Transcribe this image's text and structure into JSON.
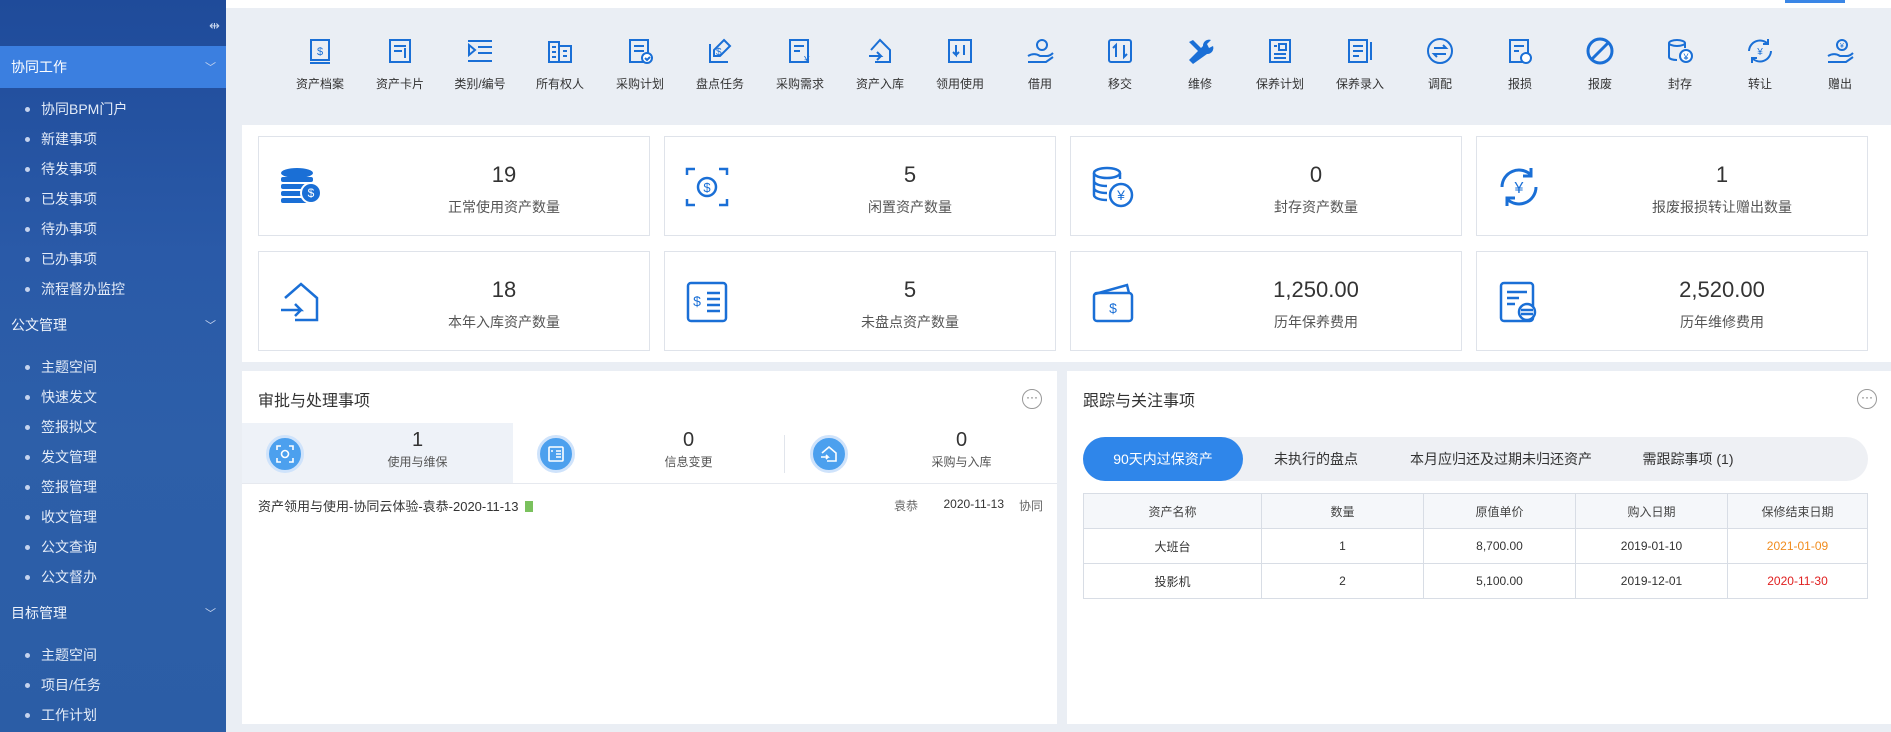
{
  "sidebar": {
    "collapse_icon": "collapse-arrows-icon",
    "groups": [
      {
        "label": "协同工作",
        "items": [
          "协同BPM门户",
          "新建事项",
          "待发事项",
          "已发事项",
          "待办事项",
          "已办事项",
          "流程督办监控"
        ]
      },
      {
        "label": "公文管理",
        "items": [
          "主题空间",
          "快速发文",
          "签报拟文",
          "发文管理",
          "签报管理",
          "收文管理",
          "公文查询",
          "公文督办"
        ]
      },
      {
        "label": "目标管理",
        "items": [
          "主题空间",
          "项目/任务",
          "工作计划"
        ]
      }
    ]
  },
  "toolbar": {
    "items": [
      {
        "label": "资产档案",
        "icon": "asset-file-icon"
      },
      {
        "label": "资产卡片",
        "icon": "asset-card-icon"
      },
      {
        "label": "类别/编号",
        "icon": "category-list-icon"
      },
      {
        "label": "所有权人",
        "icon": "building-icon"
      },
      {
        "label": "采购计划",
        "icon": "purchase-plan-icon"
      },
      {
        "label": "盘点任务",
        "icon": "inventory-task-icon"
      },
      {
        "label": "采购需求",
        "icon": "purchase-demand-icon"
      },
      {
        "label": "资产入库",
        "icon": "stock-in-icon"
      },
      {
        "label": "领用使用",
        "icon": "receive-icon"
      },
      {
        "label": "借用",
        "icon": "borrow-icon"
      },
      {
        "label": "移交",
        "icon": "transfer-arrows-icon"
      },
      {
        "label": "维修",
        "icon": "wrench-icon"
      },
      {
        "label": "保养计划",
        "icon": "maintenance-plan-icon"
      },
      {
        "label": "保养录入",
        "icon": "maintenance-entry-icon"
      },
      {
        "label": "调配",
        "icon": "exchange-icon"
      },
      {
        "label": "报损",
        "icon": "loss-report-icon"
      },
      {
        "label": "报废",
        "icon": "scrap-icon"
      },
      {
        "label": "封存",
        "icon": "seal-coins-icon"
      },
      {
        "label": "转让",
        "icon": "transfer-yen-icon"
      },
      {
        "label": "赠出",
        "icon": "donate-icon"
      }
    ]
  },
  "stats": [
    {
      "value": "19",
      "label": "正常使用资产数量",
      "icon": "coin-stack-icon"
    },
    {
      "value": "5",
      "label": "闲置资产数量",
      "icon": "idle-dollar-icon"
    },
    {
      "value": "0",
      "label": "封存资产数量",
      "icon": "sealed-yen-icon"
    },
    {
      "value": "1",
      "label": "报废报损转让赠出数量",
      "icon": "cycle-yen-icon"
    },
    {
      "value": "18",
      "label": "本年入库资产数量",
      "icon": "house-in-icon"
    },
    {
      "value": "5",
      "label": "未盘点资产数量",
      "icon": "dollar-list-icon"
    },
    {
      "value": "1,250.00",
      "label": "历年保养费用",
      "icon": "wallet-icon"
    },
    {
      "value": "2,520.00",
      "label": "历年维修费用",
      "icon": "repair-cost-icon"
    }
  ],
  "approval": {
    "title": "审批与处理事项",
    "tabs": [
      {
        "count": "1",
        "label": "使用与维保"
      },
      {
        "count": "0",
        "label": "信息变更"
      },
      {
        "count": "0",
        "label": "采购与入库"
      }
    ],
    "tasks": [
      {
        "title": "资产领用与使用-协同云体验-袁恭-2020-11-13",
        "person": "袁恭",
        "date": "2020-11-13",
        "source": "协同"
      }
    ]
  },
  "tracking": {
    "title": "跟踪与关注事项",
    "tabs": [
      "90天内过保资产",
      "未执行的盘点",
      "本月应归还及过期未归还资产",
      "需跟踪事项 (1)"
    ],
    "columns": [
      "资产名称",
      "数量",
      "原值单价",
      "购入日期",
      "保修结束日期"
    ],
    "rows": [
      [
        "大班台",
        "1",
        "8,700.00",
        "2019-01-10",
        "2021-01-09"
      ],
      [
        "投影机",
        "2",
        "5,100.00",
        "2019-12-01",
        "2020-11-30"
      ]
    ],
    "end_date_colors": [
      "#f08c1e",
      "#e02020"
    ]
  },
  "colors": {
    "primary": "#2f86ea",
    "sidebar": "#2a5aa8",
    "icon": "#1a6fd6"
  }
}
